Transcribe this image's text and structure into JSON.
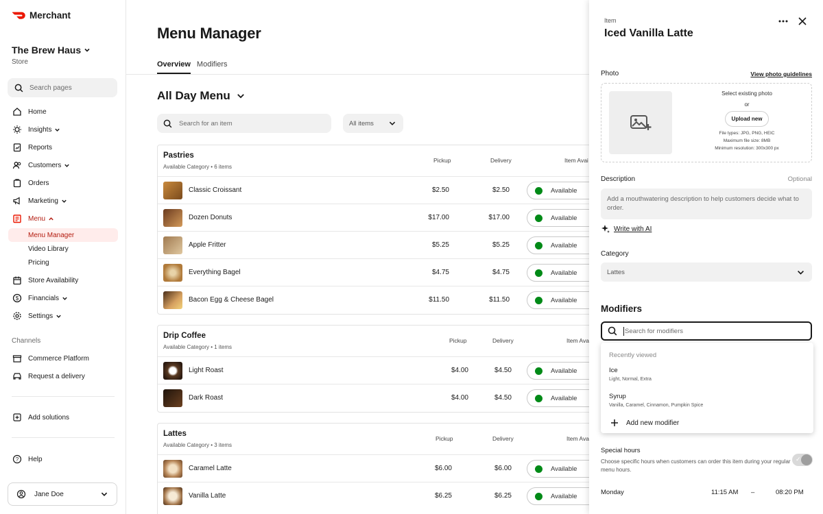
{
  "brand": {
    "name": "Merchant",
    "accent": "#eb1700"
  },
  "store": {
    "name": "The Brew Haus",
    "type": "Store"
  },
  "search_pages": {
    "placeholder": "Search pages"
  },
  "nav": [
    {
      "label": "Home",
      "icon": "home-icon"
    },
    {
      "label": "Insights",
      "icon": "lightbulb-icon",
      "chevron": "down"
    },
    {
      "label": "Reports",
      "icon": "reports-icon"
    },
    {
      "label": "Customers",
      "icon": "customers-icon",
      "chevron": "down"
    },
    {
      "label": "Orders",
      "icon": "orders-icon"
    },
    {
      "label": "Marketing",
      "icon": "megaphone-icon",
      "chevron": "down"
    },
    {
      "label": "Menu",
      "icon": "menu-book-icon",
      "chevron": "up",
      "active": true
    }
  ],
  "menu_sub": [
    "Menu Manager",
    "Video Library",
    "Pricing"
  ],
  "nav2": [
    {
      "label": "Store Availability",
      "icon": "calendar-icon"
    },
    {
      "label": "Financials",
      "icon": "dollar-icon",
      "chevron": "down"
    },
    {
      "label": "Settings",
      "icon": "gear-icon",
      "chevron": "down"
    }
  ],
  "channels": {
    "heading": "Channels",
    "items": [
      "Commerce Platform",
      "Request a delivery"
    ]
  },
  "add_solutions": "Add solutions",
  "help": "Help",
  "user": {
    "name": "Jane Doe"
  },
  "page": {
    "title": "Menu Manager",
    "tabs": [
      "Overview",
      "Modifiers"
    ],
    "menu_name": "All Day Menu",
    "item_search_placeholder": "Search for an item",
    "filter": "All items"
  },
  "columns": {
    "pickup": "Pickup",
    "delivery": "Delivery",
    "availability": "Item Avai"
  },
  "categories": [
    {
      "name": "Pastries",
      "sub": "Available Category  •  6 items",
      "items": [
        {
          "name": "Classic Croissant",
          "pickup": "$2.50",
          "delivery": "$2.50",
          "status": "Available"
        },
        {
          "name": "Dozen Donuts",
          "pickup": "$17.00",
          "delivery": "$17.00",
          "status": "Available"
        },
        {
          "name": "Apple Fritter",
          "pickup": "$5.25",
          "delivery": "$5.25",
          "status": "Available"
        },
        {
          "name": "Everything Bagel",
          "pickup": "$4.75",
          "delivery": "$4.75",
          "status": "Available"
        },
        {
          "name": "Bacon Egg & Cheese Bagel",
          "pickup": "$11.50",
          "delivery": "$11.50",
          "status": "Available"
        }
      ]
    },
    {
      "name": "Drip Coffee",
      "sub": "Available Category  •  1 items",
      "items": [
        {
          "name": "Light Roast",
          "pickup": "$4.00",
          "delivery": "$4.50",
          "status": "Available"
        },
        {
          "name": "Dark Roast",
          "pickup": "$4.00",
          "delivery": "$4.50",
          "status": "Available"
        }
      ]
    },
    {
      "name": "Lattes",
      "sub": "Available Category  •  3 items",
      "items": [
        {
          "name": "Caramel Latte",
          "pickup": "$6.00",
          "delivery": "$6.00",
          "status": "Available"
        },
        {
          "name": "Vanilla Latte",
          "pickup": "$6.25",
          "delivery": "$6.25",
          "status": "Available"
        }
      ]
    }
  ],
  "panel": {
    "label": "Item",
    "title": "Iced Vanilla Latte",
    "photo_label": "Photo",
    "photo_link": "View photo guidelines",
    "select_existing": "Select existing photo",
    "or": "or",
    "upload": "Upload new",
    "file_types": "File types: JPG, PNG, HEIC",
    "max_size": "Maximum file size: 8MB",
    "min_res": "Minimum resolution: 300x300 px",
    "description_label": "Description",
    "optional": "Optional",
    "description_placeholder": "Add a mouthwatering description to help customers decide what to order.",
    "write_ai": "Write with AI",
    "category_label": "Category",
    "category_value": "Lattes",
    "modifiers_heading": "Modifiers",
    "modifier_search_placeholder": "Search for modifiers",
    "recently_viewed": "Recently viewed",
    "recent": [
      {
        "title": "Ice",
        "options": "Light, Normal, Extra"
      },
      {
        "title": "Syrup",
        "options": "Vanilla, Caramel, Cinnamon, Pumpkin Spice"
      }
    ],
    "add_modifier": "Add new modifier",
    "special_hours": "Special hours",
    "special_desc": "Choose specific hours when customers can order this item during your regular menu hours.",
    "day": "Monday",
    "start": "11:15 AM",
    "dash": "–",
    "end": "08:20 PM"
  }
}
